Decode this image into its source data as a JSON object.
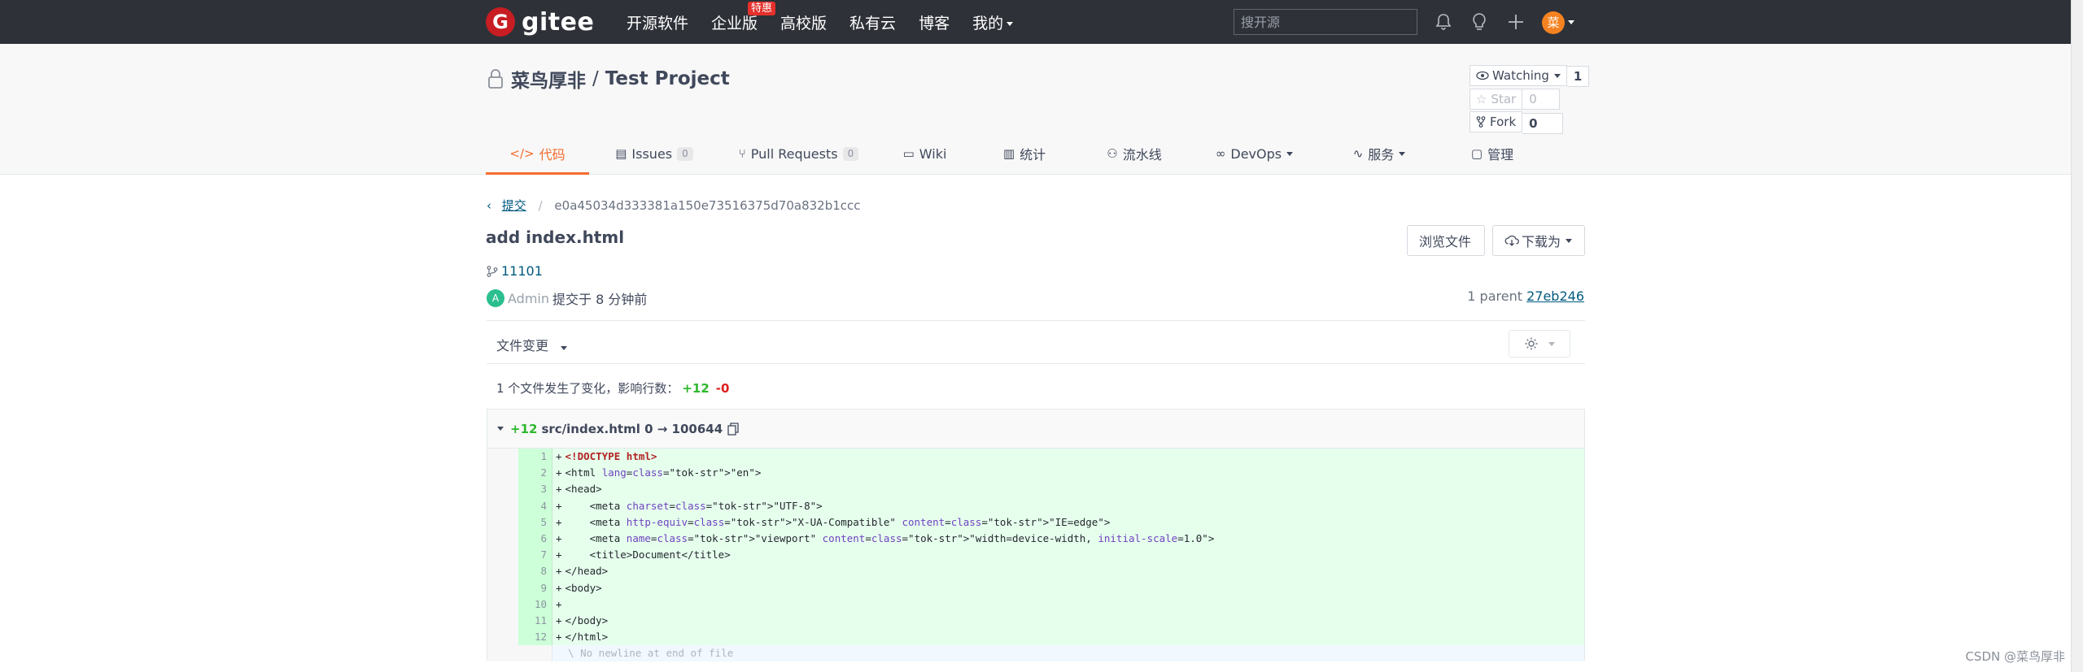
{
  "navbar": {
    "logo_mark": "G",
    "logo_text": "gitee",
    "items": [
      {
        "label": "开源软件"
      },
      {
        "label": "企业版",
        "badge": "特惠"
      },
      {
        "label": "高校版"
      },
      {
        "label": "私有云"
      },
      {
        "label": "博客"
      },
      {
        "label": "我的",
        "has_caret": true
      }
    ],
    "search_placeholder": "搜开源",
    "icons": [
      "bell-icon",
      "lightbulb-icon",
      "plus-icon"
    ],
    "avatar_letter": "菜"
  },
  "project": {
    "owner": "菜鸟厚非",
    "separator": "/",
    "name": "Test Project",
    "watch_label": "Watching",
    "watch_count": "1",
    "star_label": "Star",
    "star_count": "0",
    "fork_label": "Fork",
    "fork_count": "0"
  },
  "tabs": [
    {
      "icon": "</>",
      "label": "代码",
      "active": true
    },
    {
      "icon": "issues-icon",
      "label": "Issues",
      "count": "0"
    },
    {
      "icon": "pr-icon",
      "label": "Pull Requests",
      "count": "0"
    },
    {
      "icon": "wiki-icon",
      "label": "Wiki"
    },
    {
      "icon": "stats-icon",
      "label": "统计"
    },
    {
      "icon": "pipeline-icon",
      "label": "流水线"
    },
    {
      "icon": "devops-icon",
      "label": "DevOps",
      "caret": true
    },
    {
      "icon": "service-icon",
      "label": "服务",
      "caret": true
    },
    {
      "icon": "manage-icon",
      "label": "管理"
    }
  ],
  "commit": {
    "breadcrumb_back": "提交",
    "sha": "e0a45034d333381a150e73516375d70a832b1ccc",
    "title": "add index.html",
    "browse_files": "浏览文件",
    "download_as": "下载为",
    "branch": "11101",
    "author_initial": "A",
    "author": "Admin",
    "action": "提交于 8 分钟前",
    "parent_label": "1 parent",
    "parent_sha": "27eb246"
  },
  "file_changes": {
    "label": "文件变更",
    "summary": "1 个文件发生了变化，影响行数：",
    "additions": "+12",
    "deletions": "-0"
  },
  "diff": {
    "additions": "+12",
    "path": "src/index.html 0 → 100644",
    "lines": [
      {
        "n": "1",
        "text": "<!DOCTYPE html>"
      },
      {
        "n": "2",
        "text": "<html lang=\"en\">"
      },
      {
        "n": "3",
        "text": "<head>"
      },
      {
        "n": "4",
        "text": "    <meta charset=\"UTF-8\">"
      },
      {
        "n": "5",
        "text": "    <meta http-equiv=\"X-UA-Compatible\" content=\"IE=edge\">"
      },
      {
        "n": "6",
        "text": "    <meta name=\"viewport\" content=\"width=device-width, initial-scale=1.0\">"
      },
      {
        "n": "7",
        "text": "    <title>Document</title>"
      },
      {
        "n": "8",
        "text": "</head>"
      },
      {
        "n": "9",
        "text": "<body>"
      },
      {
        "n": "10",
        "text": ""
      },
      {
        "n": "11",
        "text": "</body>"
      },
      {
        "n": "12",
        "text": "</html>"
      }
    ],
    "no_newline": "\\ No newline at end of file"
  },
  "watermark": "CSDN @菜鸟厚非",
  "colors": {
    "accent": "#f56c2d",
    "navbar": "#2e3138",
    "link": "#005980",
    "add_bg": "#e6ffed",
    "add_text": "#2eb82e",
    "del_text": "#e02020",
    "brand": "#c71d23"
  }
}
